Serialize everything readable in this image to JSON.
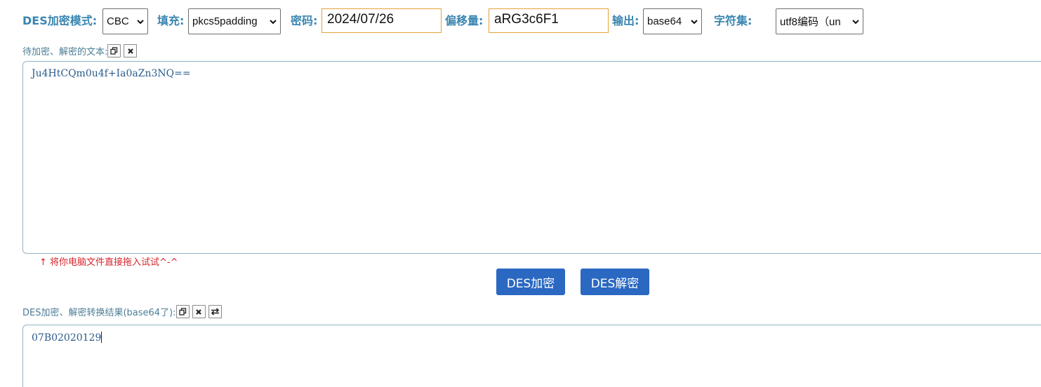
{
  "toolbar": {
    "mode_label": "DES加密模式:",
    "mode_value": "CBC",
    "padding_label": "填充:",
    "padding_value": "pkcs5padding",
    "key_label": "密码:",
    "key_value": "2024/07/26",
    "iv_label": "偏移量:",
    "iv_value": "aRG3c6F1",
    "output_label": "输出:",
    "output_value": "base64",
    "charset_label": "字符集:",
    "charset_value": "utf8编码（un"
  },
  "input_section": {
    "label": "待加密、解密的文本:",
    "copy_icon": "copy-icon",
    "clear_icon": "close-icon",
    "text": "Ju4HtCQm0u4f+Ia0aZn3NQ=="
  },
  "hint": "↑ 将你电脑文件直接拖入试试^-^",
  "buttons": {
    "encrypt": "DES加密",
    "decrypt": "DES解密"
  },
  "output_section": {
    "label": "DES加密、解密转换结果(base64了):",
    "copy_icon": "copy-icon",
    "clear_icon": "close-icon",
    "swap_icon": "swap-icon",
    "text": "07B02020129"
  },
  "colors": {
    "label": "#3a86b0",
    "button": "#2a68c2",
    "hint": "#d8232a",
    "input_border_focus": "#e5a23a"
  }
}
